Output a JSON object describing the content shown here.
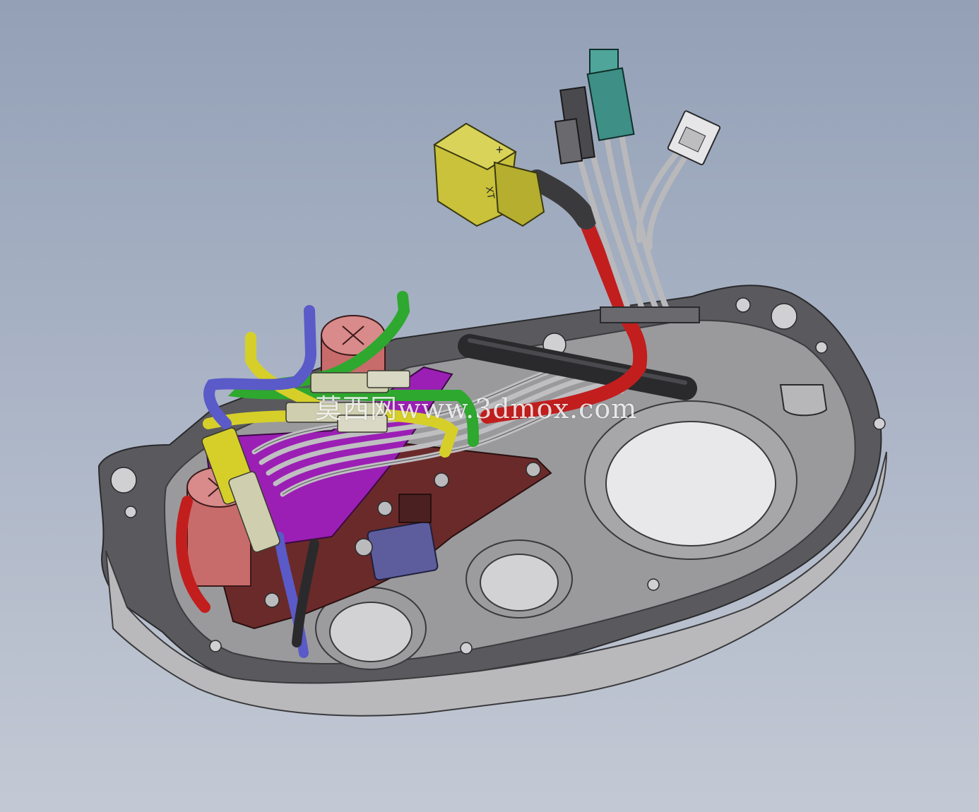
{
  "scene": {
    "subject": "cad-assembly-motor-controller-housing",
    "colors": {
      "background_top": "#93a0b6",
      "background_bottom": "#c3c9d4",
      "housing": "#8c8c8f",
      "housing_dark": "#4a4a4d",
      "pcb_purple": "#9b1fb4",
      "pcb_maroon": "#6b2a2a",
      "capacitor": "#c86b6b",
      "wire_green": "#2ea82e",
      "wire_yellow": "#d6cf2a",
      "wire_blue": "#5a5ac8",
      "wire_red": "#c21e1e",
      "connector_yellow": "#c9c23a",
      "connector_teal": "#3e8f86"
    }
  },
  "labels": {
    "connector_plus": "+",
    "connector_brand": "XT"
  },
  "watermark": {
    "text": "莫西网www.3dmox.com"
  }
}
